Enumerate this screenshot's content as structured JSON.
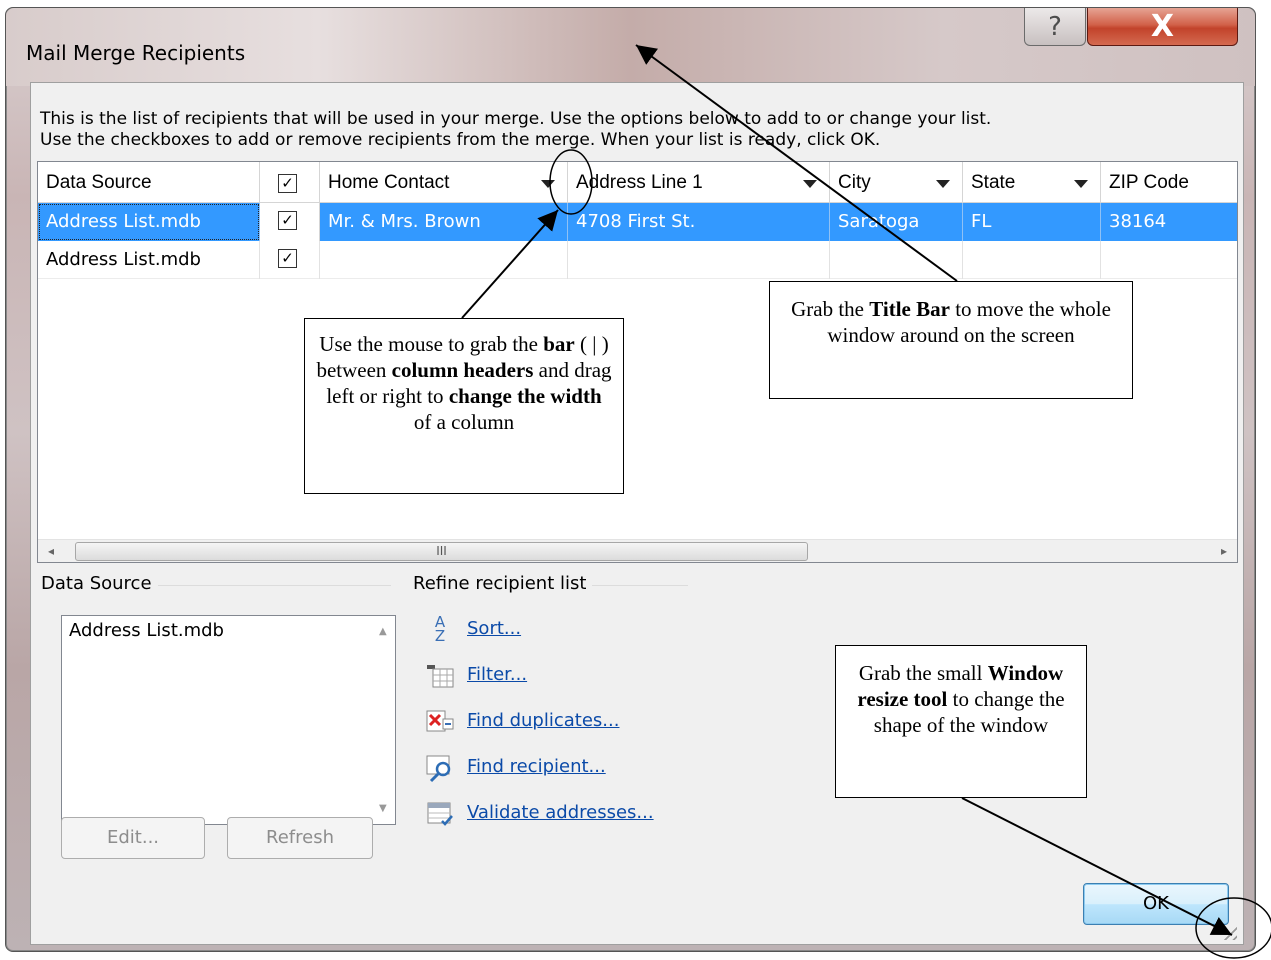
{
  "window": {
    "title": "Mail Merge Recipients",
    "help_glyph": "?",
    "close_glyph": "X"
  },
  "intro": {
    "line1": "This is the list of recipients that will be used in your merge.  Use the options below to add to or change your list.",
    "line2": "Use the checkboxes to add or remove recipients from the merge.  When your list is ready, click OK."
  },
  "grid": {
    "columns": [
      "Data Source",
      "",
      "Home Contact",
      "Address Line 1",
      "City",
      "State",
      "ZIP Code"
    ],
    "header_checkbox": "✓",
    "rows": [
      {
        "source": "Address List.mdb",
        "checked": "✓",
        "contact": "Mr. & Mrs. Brown",
        "address": "4708 First St.",
        "city": "Saratoga",
        "state": "FL",
        "zip": "38164",
        "selected": true
      },
      {
        "source": "Address List.mdb",
        "checked": "✓",
        "contact": "",
        "address": "",
        "city": "",
        "state": "",
        "zip": "",
        "selected": false
      }
    ],
    "scroll_thumb_glyph": "III",
    "scroll_left": "◂",
    "scroll_right": "▸"
  },
  "data_source_panel": {
    "label": "Data Source",
    "items": [
      "Address List.mdb"
    ],
    "edit_button": "Edit...",
    "refresh_button": "Refresh"
  },
  "refine_panel": {
    "label": "Refine recipient list",
    "links": [
      {
        "label": "Sort...",
        "icon": "sort-az-icon"
      },
      {
        "label": "Filter...",
        "icon": "filter-icon"
      },
      {
        "label": "Find duplicates...",
        "icon": "find-duplicates-icon"
      },
      {
        "label": "Find recipient...",
        "icon": "find-recipient-icon"
      },
      {
        "label": "Validate addresses...",
        "icon": "validate-addresses-icon"
      }
    ]
  },
  "ok_button": "OK",
  "annotations": {
    "column_tip": {
      "part1": "Use the mouse to grab the ",
      "b1": "bar",
      "part2": " ( | ) between ",
      "b2": "column headers",
      "part3": " and drag left or right to ",
      "b3": "change the width",
      "part4": " of a column"
    },
    "titlebar_tip": {
      "part1": "Grab the ",
      "b1": "Title Bar",
      "part2": " to move the whole window around on the screen"
    },
    "resize_tip": {
      "part1": "Grab the small ",
      "b1": "Window resize tool",
      "part2": " to change the shape of the window"
    }
  }
}
